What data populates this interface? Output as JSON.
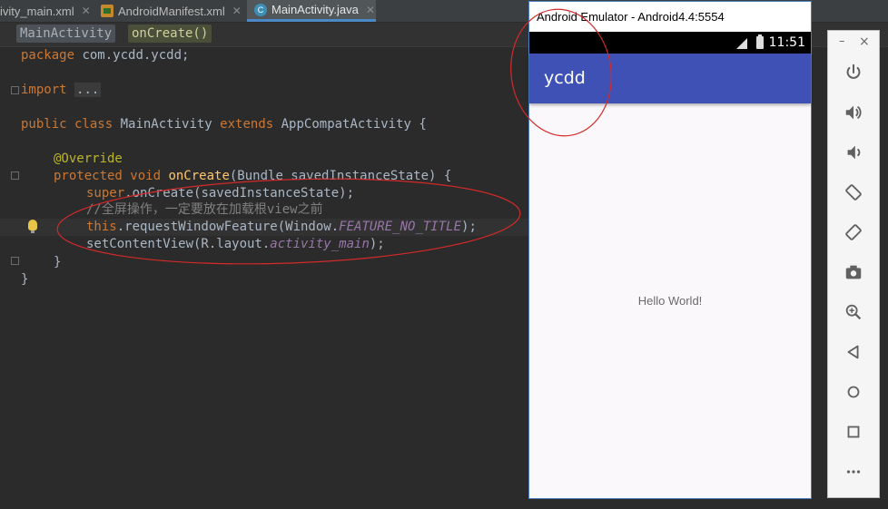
{
  "ide": {
    "tabs": [
      {
        "label": "ivity_main.xml",
        "active": false
      },
      {
        "label": "AndroidManifest.xml",
        "active": false
      },
      {
        "label": "MainActivity.java",
        "active": true
      }
    ],
    "breadcrumb": [
      "MainActivity",
      "onCreate()"
    ],
    "code": {
      "package_kw": "package",
      "package_name": " com.ycdd.ycdd;",
      "import_kw": "import",
      "import_fold": "...",
      "class_public": "public",
      "class_kw": " class ",
      "class_name": "MainActivity ",
      "extends_kw": "extends",
      "superclass": " AppCompatActivity {",
      "annotation": "@Override",
      "method_mods": "protected void ",
      "method_name": "onCreate",
      "method_params": "(Bundle savedInstanceState) {",
      "super_kw": "super",
      "super_call": ".onCreate(savedInstanceState);",
      "comment": "//全屏操作，一定要放在加载根view之前",
      "this_kw": "this",
      "request_call": ".requestWindowFeature(Window.",
      "feature_const": "FEATURE_NO_TITLE",
      "request_end": ");",
      "setcontent_call": "setContentView(R.layout.",
      "layout_const": "activity_main",
      "setcontent_end": ");",
      "close_method": "}",
      "close_class": "}"
    }
  },
  "emulator": {
    "window_title": "Android Emulator - Android4.4:5554",
    "status_time": "11:51",
    "app_title": "ycdd",
    "content_text": "Hello World!",
    "colors": {
      "appbar": "#3f51b5",
      "statusbar": "#000000"
    }
  },
  "emulator_toolbar": {
    "minimize": "–",
    "close": "×",
    "buttons": [
      "power-icon",
      "volume-up-icon",
      "volume-down-icon",
      "rotate-left-icon",
      "rotate-right-icon",
      "camera-icon",
      "zoom-icon",
      "back-icon",
      "home-icon",
      "overview-icon",
      "more-icon"
    ]
  }
}
